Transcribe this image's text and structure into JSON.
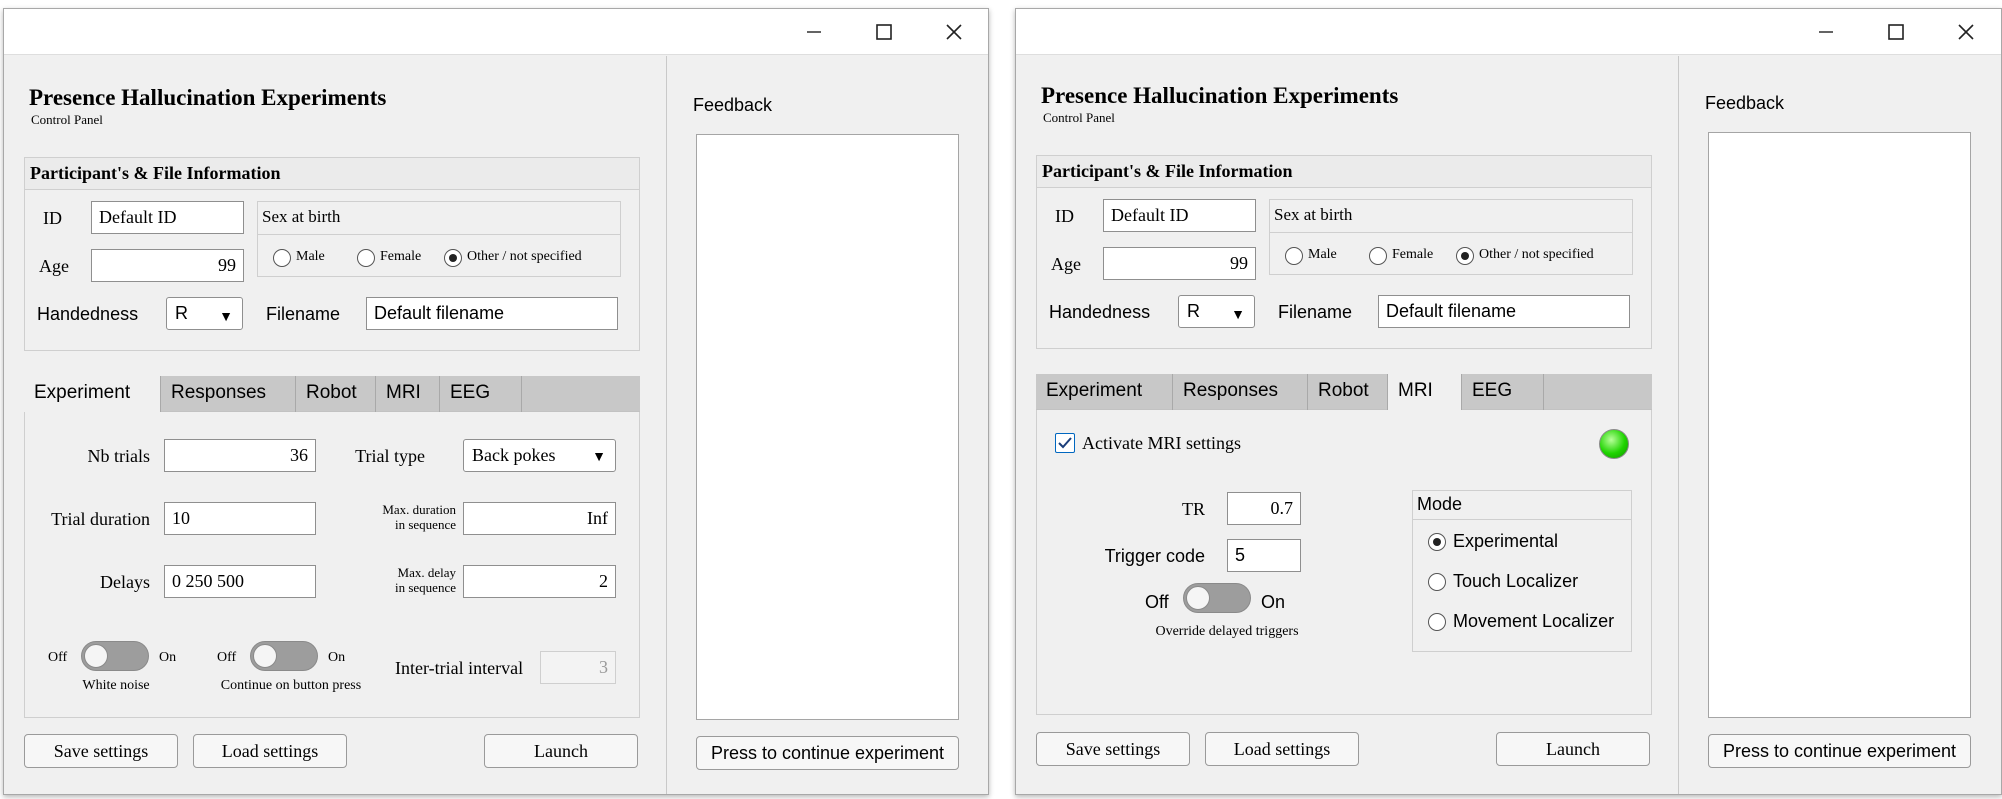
{
  "windows": [
    {
      "app_title": "Presence Hallucination Experiments",
      "app_subtitle": "Control Panel",
      "info_panel": {
        "title": "Participant's & File Information",
        "id_label": "ID",
        "id_value": "Default ID",
        "age_label": "Age",
        "age_value": "99",
        "sex_group_title": "Sex at birth",
        "sex_options": [
          "Male",
          "Female",
          "Other / not specified"
        ],
        "sex_selected": "Other / not specified",
        "handedness_label": "Handedness",
        "handedness_value": "R",
        "filename_label": "Filename",
        "filename_value": "Default filename"
      },
      "tabs": [
        "Experiment",
        "Responses",
        "Robot",
        "MRI",
        "EEG"
      ],
      "active_tab": "Experiment",
      "experiment_tab": {
        "nb_trials_label": "Nb trials",
        "nb_trials_value": "36",
        "trial_type_label": "Trial type",
        "trial_type_value": "Back pokes",
        "trial_duration_label": "Trial duration",
        "trial_duration_value": "10",
        "max_duration_label_line1": "Max. duration",
        "max_duration_label_line2": "in sequence",
        "max_duration_value": "Inf",
        "delays_label": "Delays",
        "delays_value": "0 250 500",
        "max_delay_label_line1": "Max. delay",
        "max_delay_label_line2": "in sequence",
        "max_delay_value": "2",
        "white_noise_off": "Off",
        "white_noise_on": "On",
        "white_noise_label": "White noise",
        "continue_off": "Off",
        "continue_on": "On",
        "continue_label": "Continue on button press",
        "iti_label": "Inter-trial interval",
        "iti_value": "3"
      },
      "buttons": {
        "save": "Save settings",
        "load": "Load settings",
        "launch": "Launch"
      },
      "feedback": {
        "label": "Feedback",
        "continue_button": "Press to continue experiment"
      }
    },
    {
      "app_title": "Presence Hallucination Experiments",
      "app_subtitle": "Control Panel",
      "info_panel": {
        "title": "Participant's & File Information",
        "id_label": "ID",
        "id_value": "Default ID",
        "age_label": "Age",
        "age_value": "99",
        "sex_group_title": "Sex at birth",
        "sex_options": [
          "Male",
          "Female",
          "Other / not specified"
        ],
        "sex_selected": "Other / not specified",
        "handedness_label": "Handedness",
        "handedness_value": "R",
        "filename_label": "Filename",
        "filename_value": "Default filename"
      },
      "tabs": [
        "Experiment",
        "Responses",
        "Robot",
        "MRI",
        "EEG"
      ],
      "active_tab": "MRI",
      "mri_tab": {
        "activate_label": "Activate MRI settings",
        "activate_checked": true,
        "status_lamp_color": "#1fd400",
        "tr_label": "TR",
        "tr_value": "0.7",
        "trigger_code_label": "Trigger code",
        "trigger_code_value": "5",
        "override_off": "Off",
        "override_on": "On",
        "override_label": "Override delayed triggers",
        "mode_title": "Mode",
        "mode_options": [
          "Experimental",
          "Touch Localizer",
          "Movement Localizer"
        ],
        "mode_selected": "Experimental"
      },
      "buttons": {
        "save": "Save settings",
        "load": "Load settings",
        "launch": "Launch"
      },
      "feedback": {
        "label": "Feedback",
        "continue_button": "Press to continue experiment"
      }
    }
  ],
  "colors": {
    "window_bg": "#f0f0f0",
    "tab_bar": "#c8c8c8",
    "toggle_track": "#9d9d9d",
    "checkbox_accent": "#0067c0"
  },
  "icons": [
    "minimize-icon",
    "maximize-icon",
    "close-icon",
    "dropdown-arrow-icon",
    "checkmark-icon",
    "status-lamp-icon"
  ]
}
